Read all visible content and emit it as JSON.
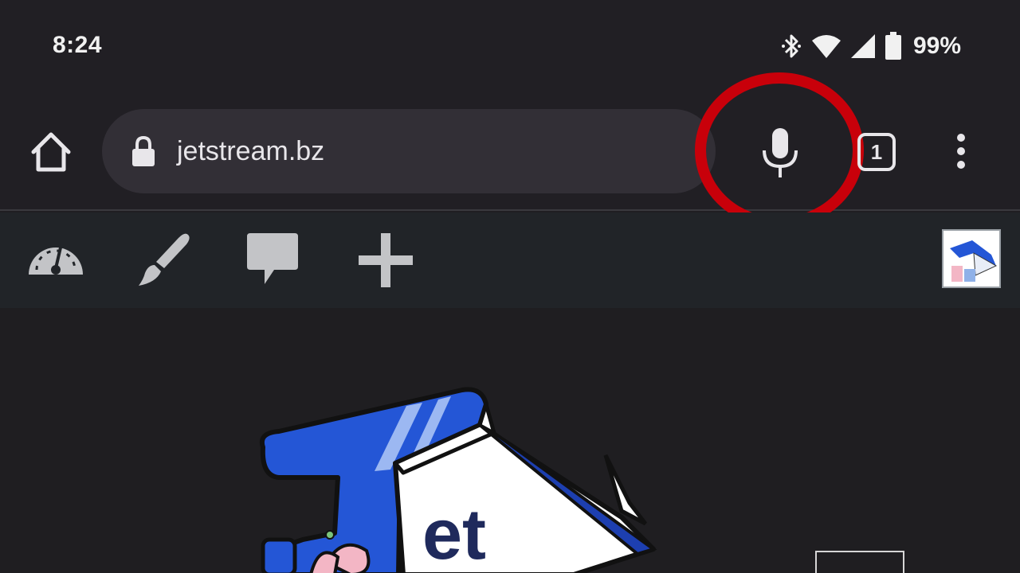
{
  "status_bar": {
    "time": "8:24",
    "battery_percent": "99%",
    "icons": [
      "bluetooth-icon",
      "wifi-icon",
      "cell-signal-icon",
      "battery-icon"
    ]
  },
  "toolbar": {
    "url": "jetstream.bz",
    "tab_count": "1",
    "icons": [
      "home-icon",
      "lock-icon",
      "microphone-icon",
      "tabs-icon",
      "more-vert-icon"
    ],
    "highlight_color": "#c8000a"
  },
  "admin_bar": {
    "items": [
      "dashboard-icon",
      "customize-brush-icon",
      "comments-icon",
      "new-plus-icon"
    ],
    "avatar": "site-avatar"
  },
  "colors": {
    "background": "#211f24",
    "omnibox": "#322f36",
    "admin_bar": "#212428",
    "logo_blue": "#2456d6"
  }
}
